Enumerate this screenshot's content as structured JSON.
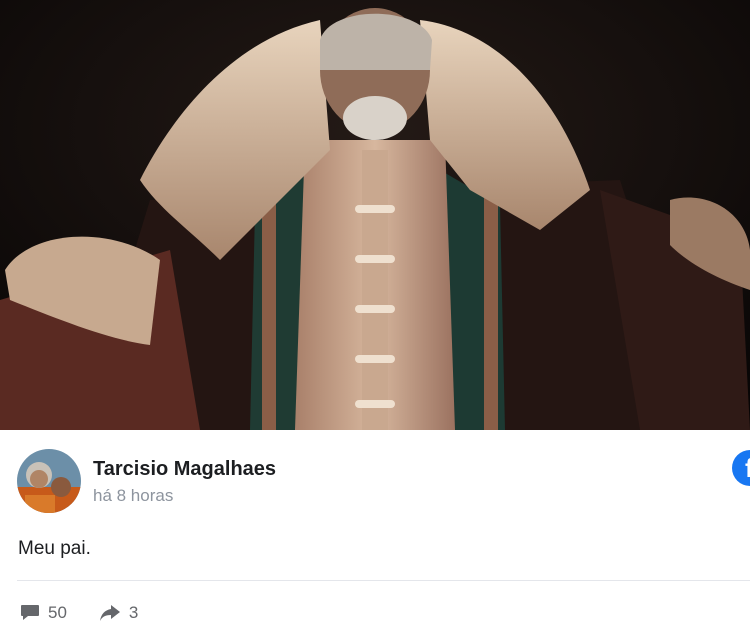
{
  "post": {
    "author": "Tarcisio Magalhaes",
    "time": "há 8 horas",
    "text": "Meu pai.",
    "comments": "50",
    "shares": "3"
  },
  "icons": {
    "comment": "comment-icon",
    "share": "share-icon",
    "facebook": "facebook-icon"
  },
  "colors": {
    "facebook_blue": "#1877f2",
    "secondary_text": "#65676b"
  }
}
